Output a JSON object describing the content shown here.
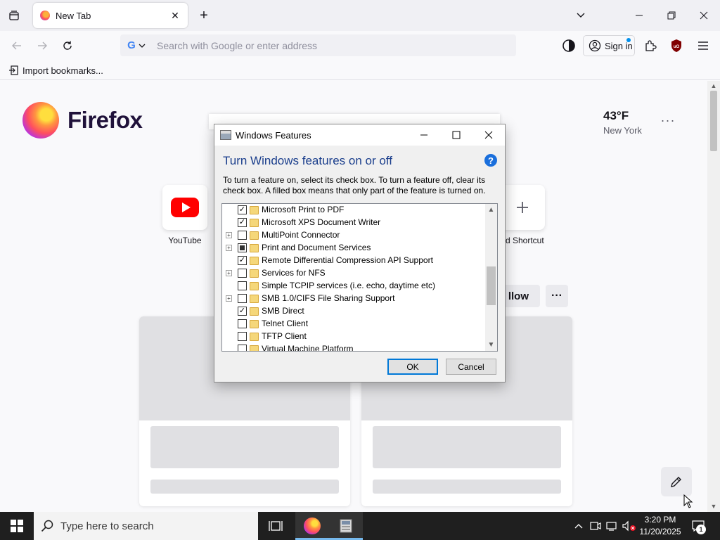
{
  "browser": {
    "tab": {
      "title": "New Tab"
    },
    "urlbar": {
      "placeholder": "Search with Google or enter address",
      "engine_icon": "google-g-icon"
    },
    "toolbar": {
      "signin_label": "Sign in"
    },
    "bookmarks": {
      "import_label": "Import bookmarks..."
    }
  },
  "newtab": {
    "brand": "Firefox",
    "weather": {
      "temp": "43°F",
      "city": "New York"
    },
    "shortcuts": [
      {
        "label": "YouTube",
        "icon": "youtube-icon"
      },
      {
        "label": "Add Shortcut",
        "icon": "plus-icon"
      }
    ],
    "visible_shortcut_label": "dd Shortcut",
    "follow_label": "llow",
    "more_label": "···"
  },
  "dialog": {
    "title": "Windows Features",
    "heading": "Turn Windows features on or off",
    "description": "To turn a feature on, select its check box. To turn a feature off, clear its check box. A filled box means that only part of the feature is turned on.",
    "features": [
      {
        "label": "Microsoft Print to PDF",
        "state": "checked",
        "expandable": false
      },
      {
        "label": "Microsoft XPS Document Writer",
        "state": "checked",
        "expandable": false
      },
      {
        "label": "MultiPoint Connector",
        "state": "unchecked",
        "expandable": true
      },
      {
        "label": "Print and Document Services",
        "state": "partial",
        "expandable": true
      },
      {
        "label": "Remote Differential Compression API Support",
        "state": "checked",
        "expandable": false
      },
      {
        "label": "Services for NFS",
        "state": "unchecked",
        "expandable": true
      },
      {
        "label": "Simple TCPIP services (i.e. echo, daytime etc)",
        "state": "unchecked",
        "expandable": false
      },
      {
        "label": "SMB 1.0/CIFS File Sharing Support",
        "state": "unchecked",
        "expandable": true
      },
      {
        "label": "SMB Direct",
        "state": "checked",
        "expandable": false
      },
      {
        "label": "Telnet Client",
        "state": "unchecked",
        "expandable": false
      },
      {
        "label": "TFTP Client",
        "state": "unchecked",
        "expandable": false
      },
      {
        "label": "Virtual Machine Platform",
        "state": "unchecked",
        "expandable": false
      }
    ],
    "ok_label": "OK",
    "cancel_label": "Cancel"
  },
  "taskbar": {
    "search_placeholder": "Type here to search",
    "time": "3:20 PM",
    "date": "11/20/2025",
    "notification_count": "1"
  },
  "colors": {
    "dialog_heading": "#1a3e8c",
    "ok_border": "#0078d7",
    "taskbar": "#1f1f1f"
  }
}
